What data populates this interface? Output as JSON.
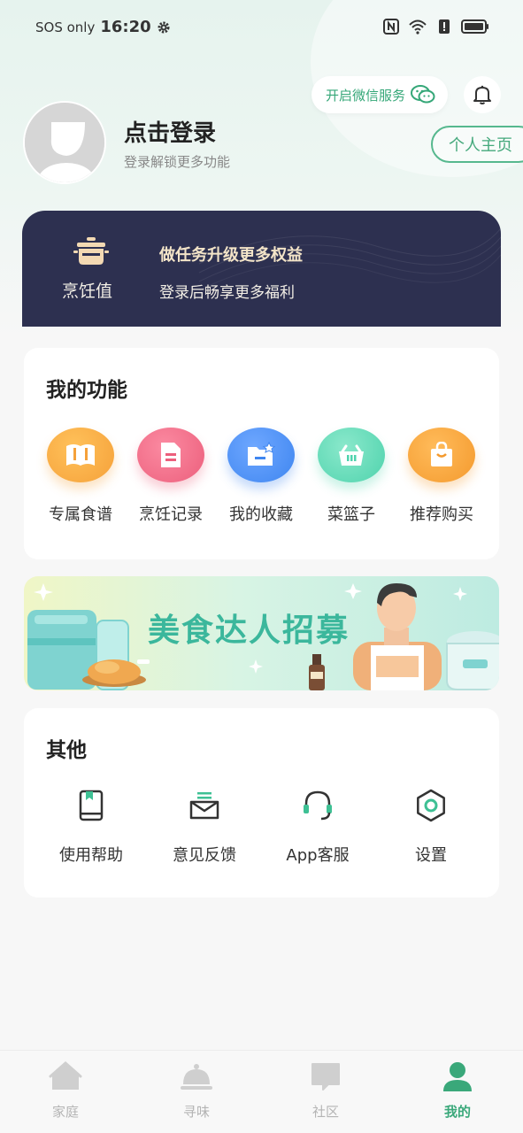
{
  "status_bar": {
    "carrier": "SOS only",
    "time": "16:20",
    "icons": [
      "settings-gear-icon",
      "nfc-icon",
      "wifi-icon",
      "alert-icon",
      "battery-icon"
    ]
  },
  "header": {
    "wechat_button": "开启微信服务",
    "login_title": "点击登录",
    "login_subtitle": "登录解锁更多功能",
    "profile_button": "个人主页"
  },
  "cooking_card": {
    "label": "烹饪值",
    "title": "做任务升级更多权益",
    "subtitle": "登录后畅享更多福利"
  },
  "my_functions": {
    "title": "我的功能",
    "items": [
      {
        "label": "专属食谱",
        "icon": "book-icon",
        "color": "#f5a13a"
      },
      {
        "label": "烹饪记录",
        "icon": "document-icon",
        "color": "#ec5f7c"
      },
      {
        "label": "我的收藏",
        "icon": "folder-star-icon",
        "color": "#3f86f0"
      },
      {
        "label": "菜篮子",
        "icon": "basket-icon",
        "color": "#4fd3ad"
      },
      {
        "label": "推荐购买",
        "icon": "shopping-bag-icon",
        "color": "#f49a2e"
      }
    ]
  },
  "banner": {
    "text": "美食达人招募"
  },
  "others": {
    "title": "其他",
    "items": [
      {
        "label": "使用帮助",
        "icon": "help-book-icon"
      },
      {
        "label": "意见反馈",
        "icon": "feedback-mail-icon"
      },
      {
        "label": "App客服",
        "icon": "headset-icon"
      },
      {
        "label": "设置",
        "icon": "settings-icon"
      }
    ]
  },
  "tabbar": {
    "active": "我的",
    "items": [
      {
        "label": "家庭",
        "icon": "home-icon"
      },
      {
        "label": "寻味",
        "icon": "dish-cover-icon"
      },
      {
        "label": "社区",
        "icon": "chat-bubble-icon"
      },
      {
        "label": "我的",
        "icon": "person-icon"
      }
    ]
  }
}
